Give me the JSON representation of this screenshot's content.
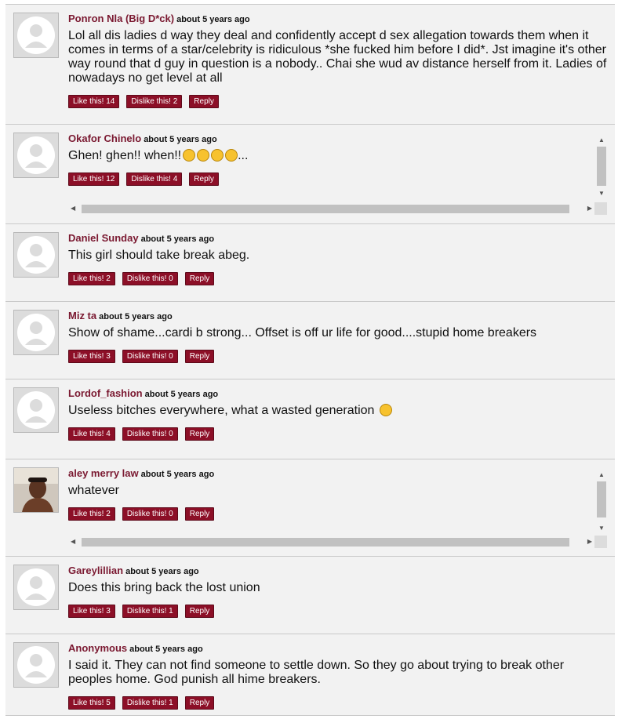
{
  "comments": [
    {
      "user": "Ponron Nla (Big D*ck)",
      "time": "about 5 years ago",
      "text": "Lol all dis ladies d way they deal and confidently accept d sex allegation towards them when it comes in terms of a star/celebrity is ridiculous *she fucked him before I did*. Jst imagine it's other way round that d guy in question is a nobody.. Chai she wud av distance herself from it. Ladies of nowadays no get level at all",
      "like": "Like this! 14",
      "dislike": "Dislike this! 2",
      "reply": "Reply"
    },
    {
      "user": "Okafor Chinelo",
      "time": "about 5 years ago",
      "text": "Ghen! ghen!! when!!",
      "text_suffix": "...",
      "emojis": [
        "eye-roll-emoji",
        "eye-roll-emoji",
        "eye-roll-emoji",
        "thinking-emoji"
      ],
      "like": "Like this! 12",
      "dislike": "Dislike this! 4",
      "reply": "Reply"
    },
    {
      "user": "Daniel Sunday",
      "time": "about 5 years ago",
      "text": "This girl should take break abeg.",
      "like": "Like this! 2",
      "dislike": "Dislike this! 0",
      "reply": "Reply"
    },
    {
      "user": "Miz ta",
      "time": "about 5 years ago",
      "text": "Show of shame...cardi b strong... Offset is off ur life for good....stupid home breakers",
      "like": "Like this! 3",
      "dislike": "Dislike this! 0",
      "reply": "Reply"
    },
    {
      "user": "Lordof_fashion",
      "time": "about 5 years ago",
      "text": "Useless bitches everywhere, what a wasted generation",
      "emojis": [
        "crying-emoji"
      ],
      "like": "Like this! 4",
      "dislike": "Dislike this! 0",
      "reply": "Reply"
    },
    {
      "user": "aley merry law",
      "time": "about 5 years ago",
      "text": "whatever",
      "like": "Like this! 2",
      "dislike": "Dislike this! 0",
      "reply": "Reply"
    },
    {
      "user": "Gareylillian",
      "time": "about 5 years ago",
      "text": "Does this bring back the lost union",
      "like": "Like this! 3",
      "dislike": "Dislike this! 1",
      "reply": "Reply"
    },
    {
      "user": "Anonymous",
      "time": "about 5 years ago",
      "text": "I said it. They can not find someone to settle down. So they go about trying to break other peoples home. God punish all hime breakers.",
      "like": "Like this! 5",
      "dislike": "Dislike this! 1",
      "reply": "Reply"
    }
  ],
  "colors": {
    "username": "#7a1830",
    "button_bg": "#8c0f27",
    "comment_bg": "#f2f2f2"
  }
}
